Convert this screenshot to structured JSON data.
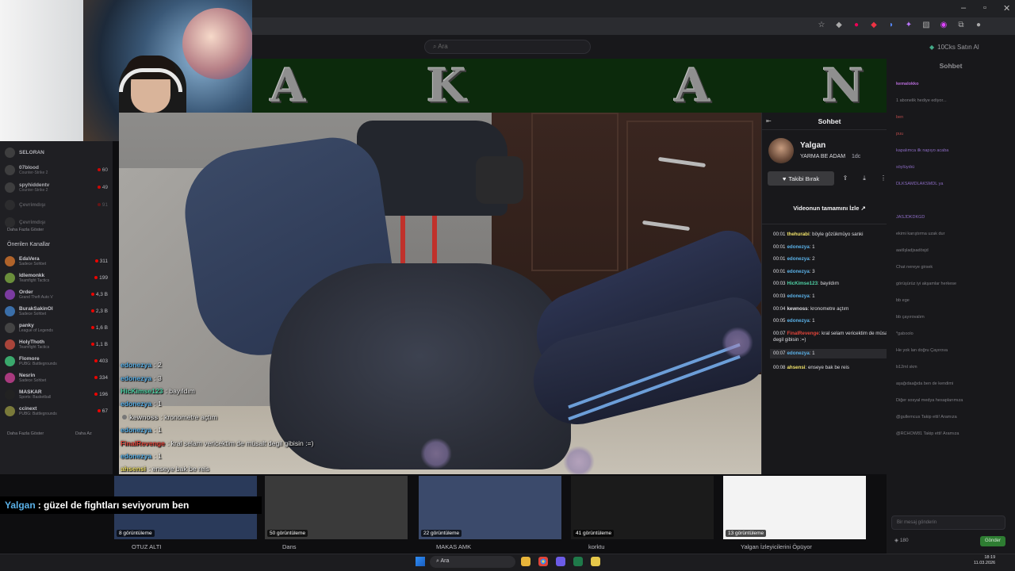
{
  "browser": {
    "window_controls": [
      "–",
      "▫",
      "✕"
    ]
  },
  "twitch_header": {
    "search_placeholder": "Ara",
    "bits_label": "10Cks Satın Al"
  },
  "banner": {
    "letters": [
      "A",
      "K",
      "A",
      "N"
    ]
  },
  "left_sidebar": {
    "channels": [
      {
        "name": "SELORAN",
        "game": "",
        "viewers": ""
      },
      {
        "name": "07blood",
        "game": "Counter-Strike 2",
        "viewers": "60"
      },
      {
        "name": "spyhiddentv",
        "game": "Counter-Strike 2",
        "viewers": "49"
      },
      {
        "name": "Çevrimdışı",
        "game": "",
        "viewers": "91"
      },
      {
        "name": "Çevrimdışı",
        "game": "",
        "viewers": ""
      }
    ],
    "more_label": "Daha Fazla Göster",
    "recommended_heading": "Önerilen Kanallar",
    "recommended": [
      {
        "name": "EdaVera",
        "game": "Sadece Sohbet",
        "viewers": "311",
        "color": "#b0632a"
      },
      {
        "name": "Idlemonkk",
        "game": "Teamfight Tactics",
        "viewers": "199",
        "color": "#6a8e3b"
      },
      {
        "name": "Order",
        "game": "Grand Theft Auto V",
        "viewers": "4,3 B",
        "color": "#7b3ba0"
      },
      {
        "name": "BurakSakinOl",
        "game": "Sadece Sohbet",
        "viewers": "2,3 B",
        "color": "#3a6ea8"
      },
      {
        "name": "panky",
        "game": "League of Legends",
        "viewers": "1,6 B",
        "color": "#444"
      },
      {
        "name": "HolyThoth",
        "game": "Teamfight Tactics",
        "viewers": "1,1 B",
        "color": "#a8443a"
      },
      {
        "name": "Flomore",
        "game": "PUBG: Battlegrounds",
        "viewers": "403",
        "color": "#3aa86c"
      },
      {
        "name": "Nesrin",
        "game": "Sadece Sohbet",
        "viewers": "334",
        "color": "#a83a7e"
      },
      {
        "name": "MASKAR",
        "game": "Sports: Basketball",
        "viewers": "196",
        "color": "#222"
      },
      {
        "name": "ccinext",
        "game": "PUBG: Battlegrounds",
        "viewers": "67",
        "color": "#7a7a3a"
      }
    ],
    "more_bottom": "Daha Fazla Göster",
    "less_bottom": "Daha Az"
  },
  "overlay_chat": [
    {
      "user": "edonezya",
      "color": "#5ab1e8",
      "text": " : 2",
      "icon": false
    },
    {
      "user": "edonezya",
      "color": "#5ab1e8",
      "text": " : 3",
      "icon": false
    },
    {
      "user": "HicKimse123",
      "color": "#4fd1a5",
      "text": " : bayıldım",
      "icon": false
    },
    {
      "user": "edonezya",
      "color": "#5ab1e8",
      "text": " : 1",
      "icon": false
    },
    {
      "user": "kewnoss",
      "color": "#d7d7d7",
      "text": " : kronometre açtım",
      "icon": true
    },
    {
      "user": "edonezya",
      "color": "#5ab1e8",
      "text": " : 1",
      "icon": false
    },
    {
      "user": "FinalRevenge",
      "color": "#e0443a",
      "text": " : kral selam vericektim de müsalt degil gibisin :=)",
      "icon": false
    },
    {
      "user": "edonezya",
      "color": "#5ab1e8",
      "text": " : 1",
      "icon": false
    },
    {
      "user": "ahsensi",
      "color": "#f0e26a",
      "text": " : enseye bak be reis",
      "icon": false
    }
  ],
  "vod_chat": {
    "header": "Sohbet",
    "streamer": "Yalgan",
    "title": "YARMA BE ADAM",
    "age": "1dc",
    "unfollow_label": "Takibi Bırak",
    "watch_full_label": "Videonun tamamını İzle",
    "messages": [
      {
        "time": "00:01",
        "user": "thehurabi",
        "color": "#f0e26a",
        "text": "böyle gözükmüyo sanki"
      },
      {
        "time": "00:01",
        "user": "edonezya",
        "color": "#5ab1e8",
        "text": "1"
      },
      {
        "time": "00:01",
        "user": "edonezya",
        "color": "#5ab1e8",
        "text": "2"
      },
      {
        "time": "00:01",
        "user": "edonezya",
        "color": "#5ab1e8",
        "text": "3"
      },
      {
        "time": "00:03",
        "user": "HicKimse123",
        "color": "#4fd1a5",
        "text": "bayıldım"
      },
      {
        "time": "00:03",
        "user": "edonezya",
        "color": "#5ab1e8",
        "text": "1"
      },
      {
        "time": "00:04",
        "user": "kewnoss",
        "color": "#dedee3",
        "text": "kronometre açtım"
      },
      {
        "time": "00:05",
        "user": "edonezya",
        "color": "#5ab1e8",
        "text": "1"
      },
      {
        "time": "00:07",
        "user": "FinalRevenge",
        "color": "#e0443a",
        "text": "kral selam vericektim de müsalt degil gibisin :=)"
      },
      {
        "time": "00:07",
        "user": "edonezya",
        "color": "#5ab1e8",
        "text": "1"
      },
      {
        "time": "00:08",
        "user": "ahsensi",
        "color": "#f0e26a",
        "text": "enseye bak be reis"
      }
    ]
  },
  "right_chat": {
    "title": "Sohbet",
    "lines": [
      {
        "user": "kemalokko",
        "color": "#b56bd6",
        "text": ""
      },
      {
        "user": "",
        "color": "#7e7e84",
        "text": "1 abonelik hediye ediyor..."
      },
      {
        "user": "",
        "color": "#b84b4b",
        "text": "ben"
      },
      {
        "user": "",
        "color": "#b84b4b",
        "text": "puu"
      },
      {
        "user": "",
        "color": "#8a6ac0",
        "text": "kapalımca ilk napıyo acaba"
      },
      {
        "user": "",
        "color": "#8a6ac0",
        "text": "söylüydıü"
      },
      {
        "user": "",
        "color": "#8a6ac0",
        "text": "DLKSAMDLAKSMDL ya"
      },
      {
        "user": "",
        "color": "#8a6ac0",
        "text": ""
      },
      {
        "user": "",
        "color": "#8a6ac0",
        "text": "JASJDKDKGD"
      },
      {
        "user": "",
        "color": "#7e7e84",
        "text": "ekimi karıştırma uzak dur"
      },
      {
        "user": "",
        "color": "#7e7e84",
        "text": "aaölşladjsadösjd"
      },
      {
        "user": "",
        "color": "#7e7e84",
        "text": "Chat nereye girsek"
      },
      {
        "user": "",
        "color": "#7e7e84",
        "text": "görüşürüz iyi akşamlar herkese"
      },
      {
        "user": "",
        "color": "#7e7e84",
        "text": "bb ege"
      },
      {
        "user": "",
        "color": "#7e7e84",
        "text": "bb çayırovalım"
      },
      {
        "user": "",
        "color": "#7e7e84",
        "text": "*gaboolo"
      },
      {
        "user": "",
        "color": "#7e7e84",
        "text": "He yok lan doğru Çayırova"
      },
      {
        "user": "",
        "color": "#7e7e84",
        "text": "b12ml skm"
      },
      {
        "user": "",
        "color": "#7e7e84",
        "text": "aşağıdaağıda ben de kendimi"
      },
      {
        "user": "",
        "color": "#7e7e84",
        "text": "Diğer sosyal medya hesaplarımıza"
      },
      {
        "user": "",
        "color": "#7e7e84",
        "text": "@gullemcus Takip etti! Aramıza"
      },
      {
        "user": "",
        "color": "#7e7e84",
        "text": "@RCHOW81 Takip etti! Aramıza"
      }
    ],
    "input_placeholder": "Bir mesaj gönderin",
    "points": "180",
    "send_label": "Gönder"
  },
  "caption": {
    "user": "Yalgan",
    "text": ": güzel de fightları seviyorum ben"
  },
  "clips": [
    {
      "views": "8 görüntüleme",
      "title": "OTUZ ALTI"
    },
    {
      "views": "50 görüntüleme",
      "title": "Dans"
    },
    {
      "views": "22 görüntüleme",
      "title": "MAKAS AMK"
    },
    {
      "views": "41 görüntüleme",
      "title": "korktu"
    },
    {
      "views": "13 görüntüleme",
      "title": "Yalgan İzleyicilerini Öpüyor"
    }
  ],
  "taskbar": {
    "search_label": "Ara",
    "time": "18:19",
    "date": "11.03.2026"
  }
}
